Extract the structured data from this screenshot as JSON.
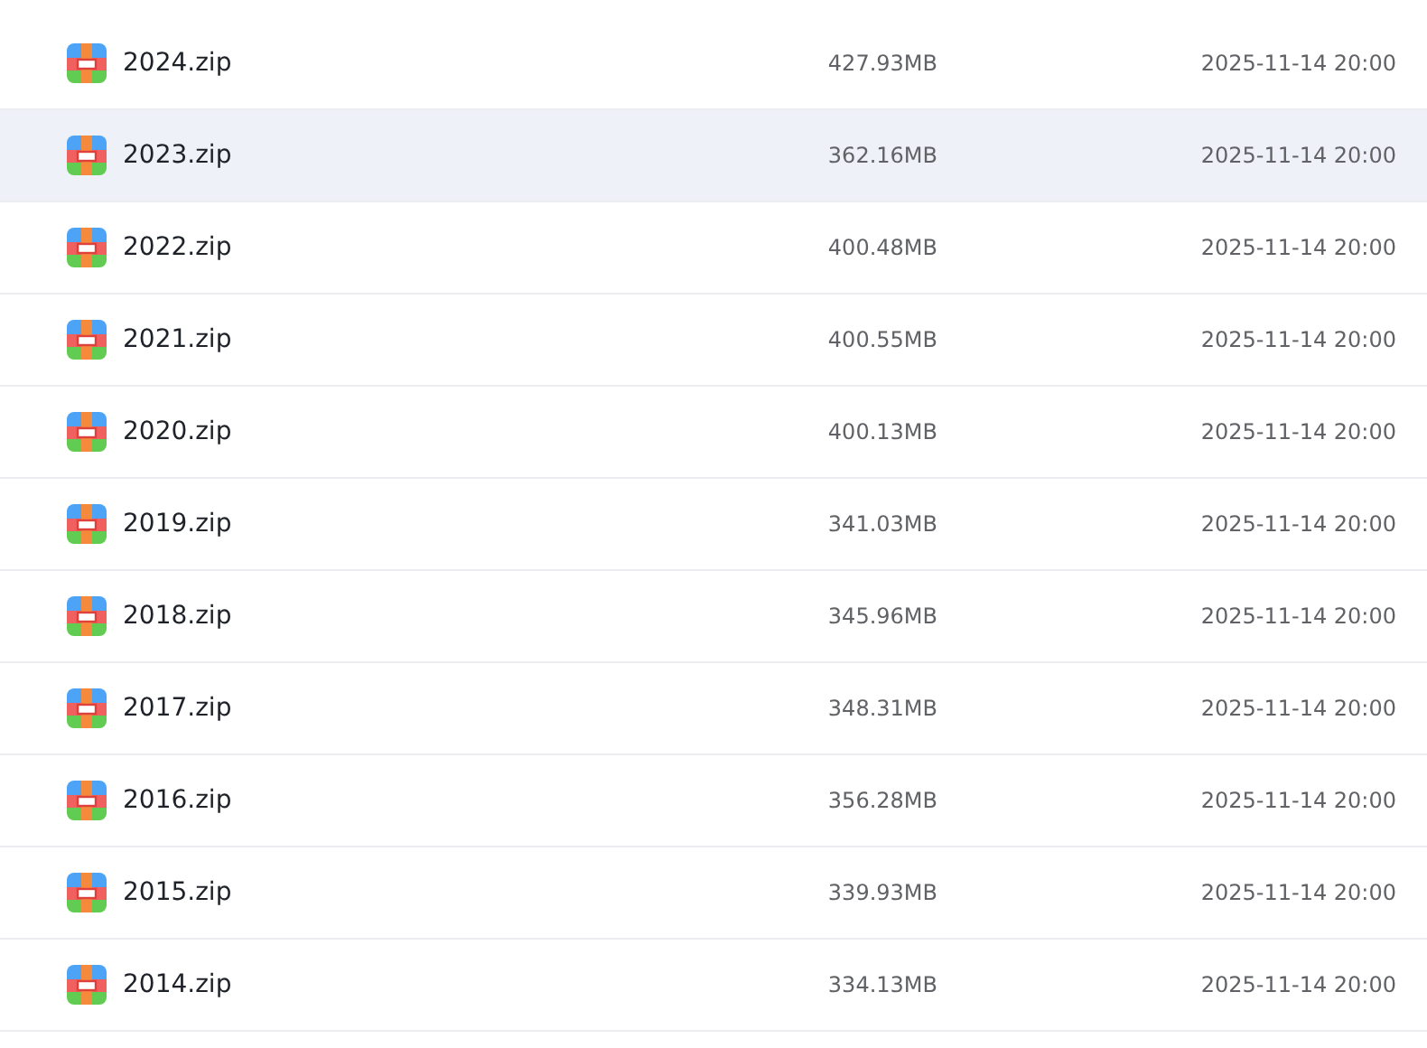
{
  "files": [
    {
      "name": "2024.zip",
      "size": "427.93MB",
      "modified": "2025-11-14 20:00",
      "selected": false
    },
    {
      "name": "2023.zip",
      "size": "362.16MB",
      "modified": "2025-11-14 20:00",
      "selected": true
    },
    {
      "name": "2022.zip",
      "size": "400.48MB",
      "modified": "2025-11-14 20:00",
      "selected": false
    },
    {
      "name": "2021.zip",
      "size": "400.55MB",
      "modified": "2025-11-14 20:00",
      "selected": false
    },
    {
      "name": "2020.zip",
      "size": "400.13MB",
      "modified": "2025-11-14 20:00",
      "selected": false
    },
    {
      "name": "2019.zip",
      "size": "341.03MB",
      "modified": "2025-11-14 20:00",
      "selected": false
    },
    {
      "name": "2018.zip",
      "size": "345.96MB",
      "modified": "2025-11-14 20:00",
      "selected": false
    },
    {
      "name": "2017.zip",
      "size": "348.31MB",
      "modified": "2025-11-14 20:00",
      "selected": false
    },
    {
      "name": "2016.zip",
      "size": "356.28MB",
      "modified": "2025-11-14 20:00",
      "selected": false
    },
    {
      "name": "2015.zip",
      "size": "339.93MB",
      "modified": "2025-11-14 20:00",
      "selected": false
    },
    {
      "name": "2014.zip",
      "size": "334.13MB",
      "modified": "2025-11-14 20:00",
      "selected": false
    }
  ]
}
